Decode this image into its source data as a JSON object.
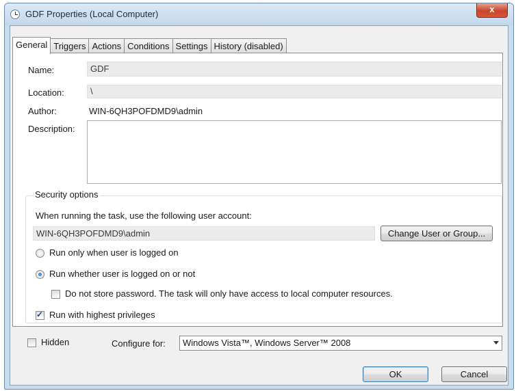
{
  "window": {
    "title": "GDF Properties (Local Computer)",
    "close_label": "x"
  },
  "tabs": [
    {
      "label": "General"
    },
    {
      "label": "Triggers"
    },
    {
      "label": "Actions"
    },
    {
      "label": "Conditions"
    },
    {
      "label": "Settings"
    },
    {
      "label": "History (disabled)"
    }
  ],
  "general": {
    "name_label": "Name:",
    "name_value": "GDF",
    "location_label": "Location:",
    "location_value": "\\",
    "author_label": "Author:",
    "author_value": "WIN-6QH3POFDMD9\\admin",
    "description_label": "Description:",
    "description_value": ""
  },
  "security": {
    "legend": "Security options",
    "account_prompt": "When running the task, use the following user account:",
    "account_value": "WIN-6QH3POFDMD9\\admin",
    "change_user_button": "Change User or Group...",
    "radio_logged_on": "Run only when user is logged on",
    "radio_whether": "Run whether user is logged on or not",
    "no_store_password": "Do not store password.  The task will only have access to local computer resources.",
    "highest_privileges": "Run with highest privileges"
  },
  "footer": {
    "hidden_label": "Hidden",
    "configure_label": "Configure for:",
    "configure_value": "Windows Vista™, Windows Server™ 2008",
    "ok_button": "OK",
    "cancel_button": "Cancel"
  }
}
